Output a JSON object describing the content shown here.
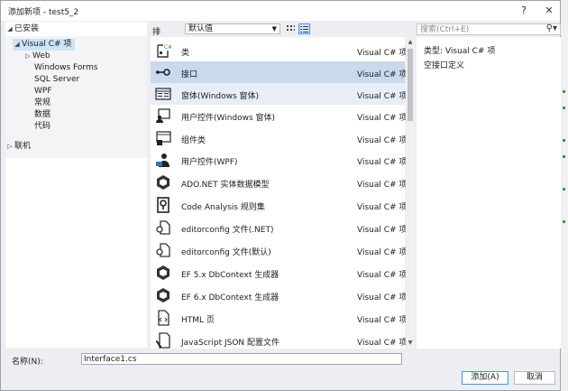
{
  "window": {
    "title": "添加新项 - test5_2",
    "help_label": "?",
    "close_label": "✕"
  },
  "tree": {
    "installed_label": "已安装",
    "root": "Visual C# 项",
    "children": [
      "Web",
      "Windows Forms",
      "SQL Server",
      "WPF",
      "常规",
      "数据",
      "代码"
    ],
    "online_label": "联机"
  },
  "toolbar": {
    "sort_label": "排序依据:",
    "sort_value": "默认值"
  },
  "search": {
    "placeholder": "搜索(Ctrl+E)"
  },
  "items": [
    {
      "name": "类",
      "lang": "Visual C# 项",
      "icon": "class-icon"
    },
    {
      "name": "接口",
      "lang": "Visual C# 项",
      "icon": "interface-icon"
    },
    {
      "name": "窗体(Windows 窗体)",
      "lang": "Visual C# 项",
      "icon": "form-icon"
    },
    {
      "name": "用户控件(Windows 窗体)",
      "lang": "Visual C# 项",
      "icon": "user-control-icon"
    },
    {
      "name": "组件类",
      "lang": "Visual C# 项",
      "icon": "component-icon"
    },
    {
      "name": "用户控件(WPF)",
      "lang": "Visual C# 项",
      "icon": "wpf-user-control-icon"
    },
    {
      "name": "ADO.NET 实体数据模型",
      "lang": "Visual C# 项",
      "icon": "entity-model-icon"
    },
    {
      "name": "Code Analysis 规则集",
      "lang": "Visual C# 项",
      "icon": "ruleset-icon"
    },
    {
      "name": "editorconfig 文件(.NET)",
      "lang": "Visual C# 项",
      "icon": "editorconfig-icon"
    },
    {
      "name": "editorconfig 文件(默认)",
      "lang": "Visual C# 项",
      "icon": "editorconfig-icon"
    },
    {
      "name": "EF 5.x DbContext 生成器",
      "lang": "Visual C# 项",
      "icon": "dbcontext-icon"
    },
    {
      "name": "EF 6.x DbContext 生成器",
      "lang": "Visual C# 项",
      "icon": "dbcontext-icon"
    },
    {
      "name": "HTML 页",
      "lang": "Visual C# 项",
      "icon": "html-page-icon"
    },
    {
      "name": "JavaScript JSON 配置文件",
      "lang": "Visual C# 项",
      "icon": "json-config-icon"
    }
  ],
  "detail": {
    "type_label": "类型:",
    "type_value": "Visual C# 项",
    "description": "空接口定义"
  },
  "footer": {
    "name_label": "名称(N):",
    "name_value": "Interface1.cs",
    "add_button": "添加(A)",
    "cancel_button": "取消"
  },
  "colors": {
    "selected_row": "#c9d9ee",
    "tree_selected": "#cce4f7",
    "accent": "#3399ff"
  }
}
